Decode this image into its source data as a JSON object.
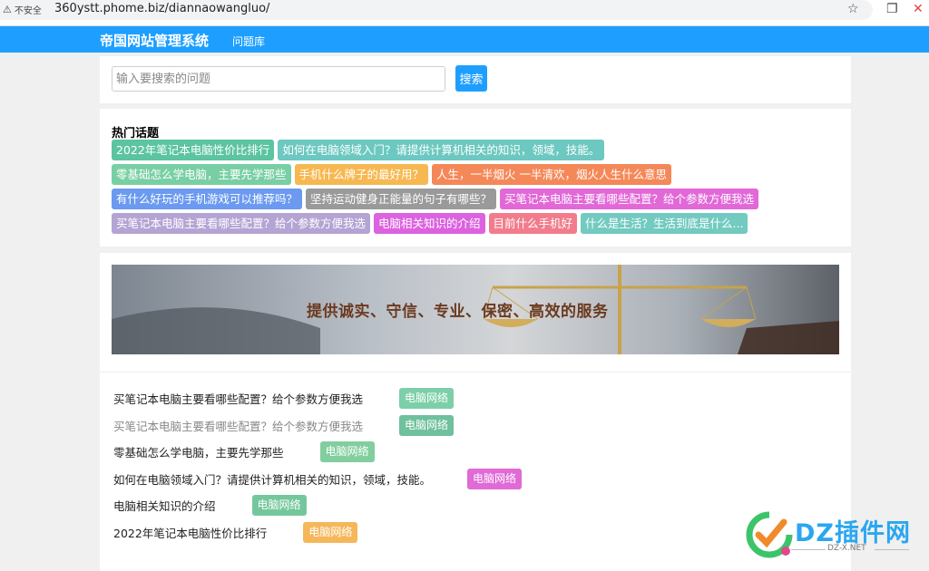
{
  "browser": {
    "security_label": "不安全",
    "url": "360ystt.phome.biz/diannaowangluo/"
  },
  "nav": {
    "brand": "帝国网站管理系统",
    "link": "问题库"
  },
  "search": {
    "placeholder": "输入要搜索的问题",
    "value": "",
    "button_label": "搜索"
  },
  "hot": {
    "title": "热门话题",
    "rows": [
      [
        {
          "label": "2022年笔记本电脑性价比排行",
          "color": "#5cc4a0"
        },
        {
          "label": "如何在电脑领域入门？请提供计算机相关的知识，领域，技能。",
          "color": "#6cc8c0"
        }
      ],
      [
        {
          "label": "零基础怎么学电脑，主要先学那些",
          "color": "#78cfa3"
        },
        {
          "label": "手机什么牌子的最好用？",
          "color": "#f7b851"
        },
        {
          "label": "人生，一半烟火 一半清欢，烟火人生什么意思",
          "color": "#f58858"
        }
      ],
      [
        {
          "label": "有什么好玩的手机游戏可以推荐吗？",
          "color": "#6b9af0"
        },
        {
          "label": "坚持运动健身正能量的句子有哪些？",
          "color": "#9a9a9a"
        },
        {
          "label": "买笔记本电脑主要看哪些配置？给个参数方便我选",
          "color": "#e268d8"
        }
      ],
      [
        {
          "label": "买笔记本电脑主要看哪些配置？给个参数方便我选",
          "color": "#b4a4d4"
        },
        {
          "label": "电脑相关知识的介绍",
          "color": "#dc62e0"
        },
        {
          "label": "目前什么手机好",
          "color": "#f27c8c"
        },
        {
          "label": "什么是生活？生活到底是什么...",
          "color": "#72cac0"
        }
      ]
    ]
  },
  "banner": {
    "text": "提供诚实、守信、专业、保密、高效的服务"
  },
  "list": [
    {
      "title": "买笔记本电脑主要看哪些配置？给个参数方便我选",
      "category": "电脑网络",
      "color": "#7ccfa8",
      "dim": false,
      "gap": 40
    },
    {
      "title": "买笔记本电脑主要看哪些配置？给个参数方便我选",
      "category": "电脑网络",
      "color": "#6fc09c",
      "dim": true,
      "gap": 40
    },
    {
      "title": "零基础怎么学电脑，主要先学那些",
      "category": "电脑网络",
      "color": "#82ce9e",
      "dim": false,
      "gap": 40
    },
    {
      "title": "如何在电脑领域入门？请提供计算机相关的知识，领域，技能。",
      "category": "电脑网络",
      "color": "#e06ad6",
      "dim": false,
      "gap": 40
    },
    {
      "title": "电脑相关知识的介绍",
      "category": "电脑网络",
      "color": "#74c79c",
      "dim": false,
      "gap": 40
    },
    {
      "title": "2022年笔记本电脑性价比排行",
      "category": "电脑网络",
      "color": "#f6b75a",
      "dim": false,
      "gap": 40
    }
  ],
  "watermark": {
    "text": "DZ插件网",
    "sub": "DZ-X.NET"
  }
}
